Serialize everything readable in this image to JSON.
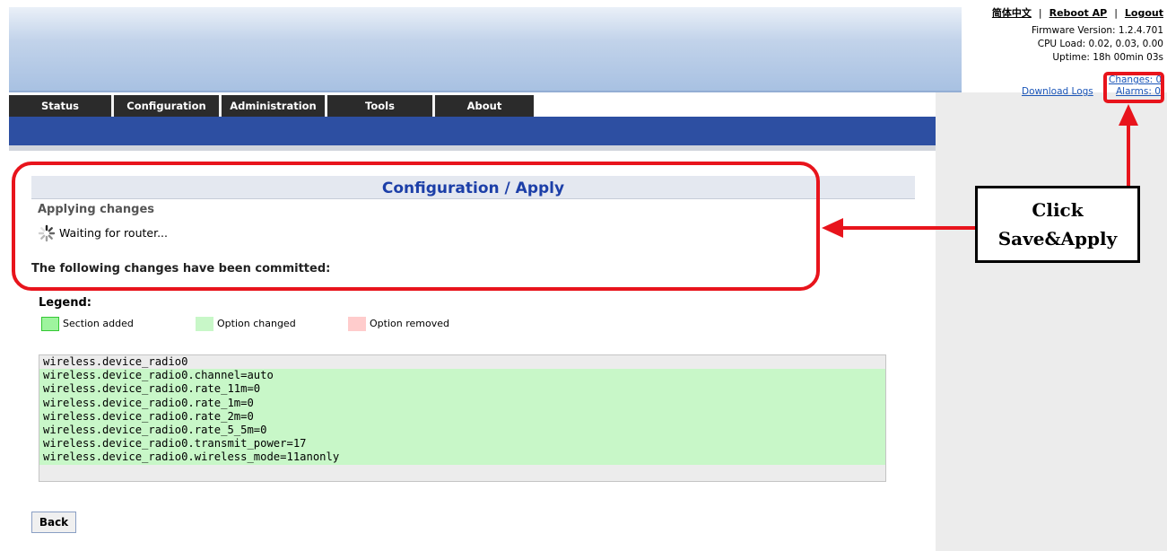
{
  "header": {
    "language_link": "简体中文",
    "reboot_link": "Reboot AP",
    "logout_link": "Logout",
    "firmware": "Firmware Version: 1.2.4.701",
    "cpu_load": "CPU Load: 0.02, 0.03, 0.00",
    "uptime": "Uptime: 18h 00min 03s",
    "changes_link": "Changes: 0",
    "alarms_link": "Alarms: 0",
    "download_logs": "Download Logs"
  },
  "tabs": [
    "Status",
    "Configuration",
    "Administration",
    "Tools",
    "About"
  ],
  "main": {
    "title": "Configuration / Apply",
    "applying_title": "Applying changes",
    "waiting_text": "Waiting for router...",
    "committed_text": "The following changes have been committed:"
  },
  "legend": {
    "title": "Legend:",
    "items": [
      {
        "label": "Section added",
        "color": "#9ef49e",
        "border": "#34c834"
      },
      {
        "label": "Option changed",
        "color": "#c8f7c8",
        "border": "#c8f7c8"
      },
      {
        "label": "Option removed",
        "color": "#ffcccc",
        "border": "#ffcccc"
      }
    ]
  },
  "changes": [
    {
      "text": "wireless.device_radio0",
      "changed": false
    },
    {
      "text": "wireless.device_radio0.channel=auto",
      "changed": true
    },
    {
      "text": "wireless.device_radio0.rate_11m=0",
      "changed": true
    },
    {
      "text": "wireless.device_radio0.rate_1m=0",
      "changed": true
    },
    {
      "text": "wireless.device_radio0.rate_2m=0",
      "changed": true
    },
    {
      "text": "wireless.device_radio0.rate_5_5m=0",
      "changed": true
    },
    {
      "text": "wireless.device_radio0.transmit_power=17",
      "changed": true
    },
    {
      "text": "wireless.device_radio0.wireless_mode=11anonly",
      "changed": true
    }
  ],
  "back_button": "Back",
  "annotation": {
    "line1": "Click",
    "line2": "Save&Apply"
  },
  "colors": {
    "accent_red": "#e8141c",
    "nav_blue": "#2d4fa2",
    "title_blue": "#1c3fa8"
  }
}
